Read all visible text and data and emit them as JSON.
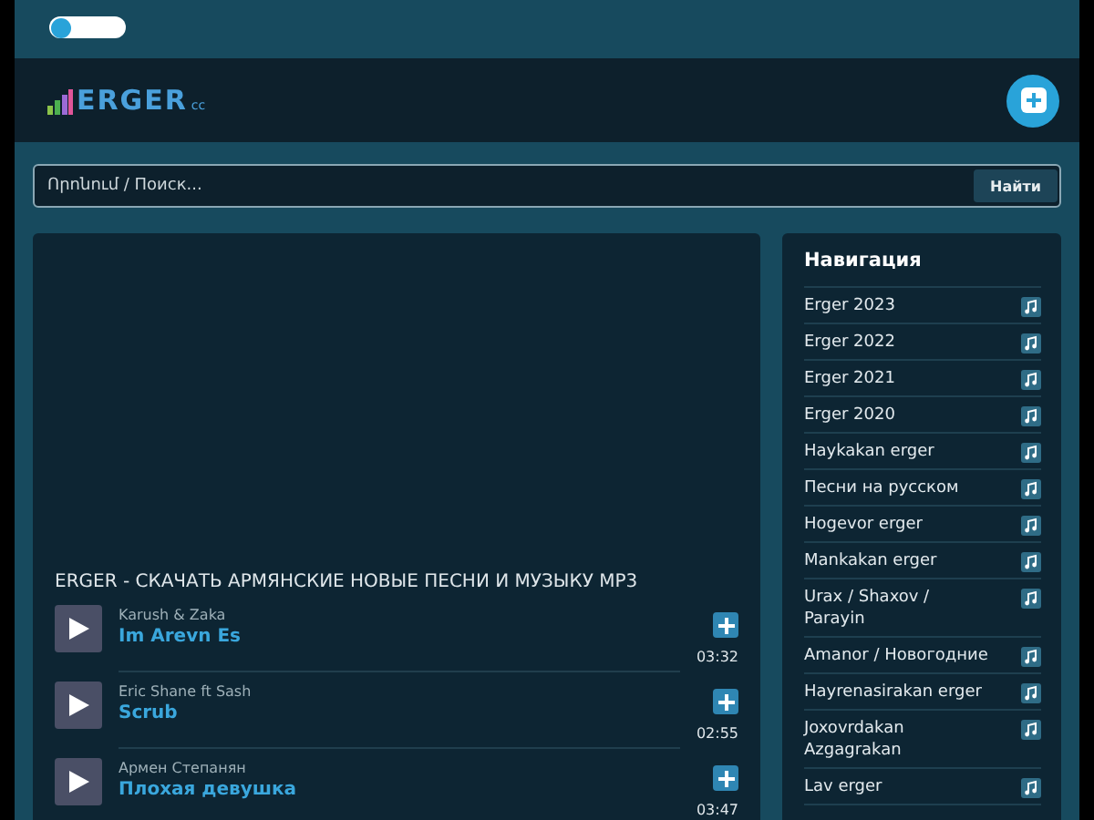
{
  "topbar": {
    "theme_toggle": {
      "on": false
    }
  },
  "header": {
    "logo": {
      "name": "ERGER",
      "suffix": "cc"
    }
  },
  "search": {
    "placeholder": "Որոնում / Поиск...",
    "button": "Найти"
  },
  "main": {
    "title": "ERGER - СКАЧАТЬ АРМЯНСКИЕ НОВЫЕ ПЕСНИ И МУЗЫКУ MP3",
    "tracks": [
      {
        "artist": "Karush & Zaka",
        "title": "Im Arevn Es",
        "duration": "03:32"
      },
      {
        "artist": "Eric Shane ft Sash",
        "title": "Scrub",
        "duration": "02:55"
      },
      {
        "artist": "Армен Степанян",
        "title": "Плохая девушка",
        "duration": "03:47"
      }
    ]
  },
  "navigation": {
    "title": "Навигация",
    "items": [
      "Erger 2023",
      "Erger 2022",
      "Erger 2021",
      "Erger 2020",
      "Haykakan erger",
      "Песни на русском",
      "Hogevor erger",
      "Mankakan erger",
      "Urax / Shaxov / Parayin",
      "Amanor / Новогодние",
      "Hayrenasirakan erger",
      "Joxovrdakan Azgagrakan",
      "Lav erger"
    ]
  }
}
